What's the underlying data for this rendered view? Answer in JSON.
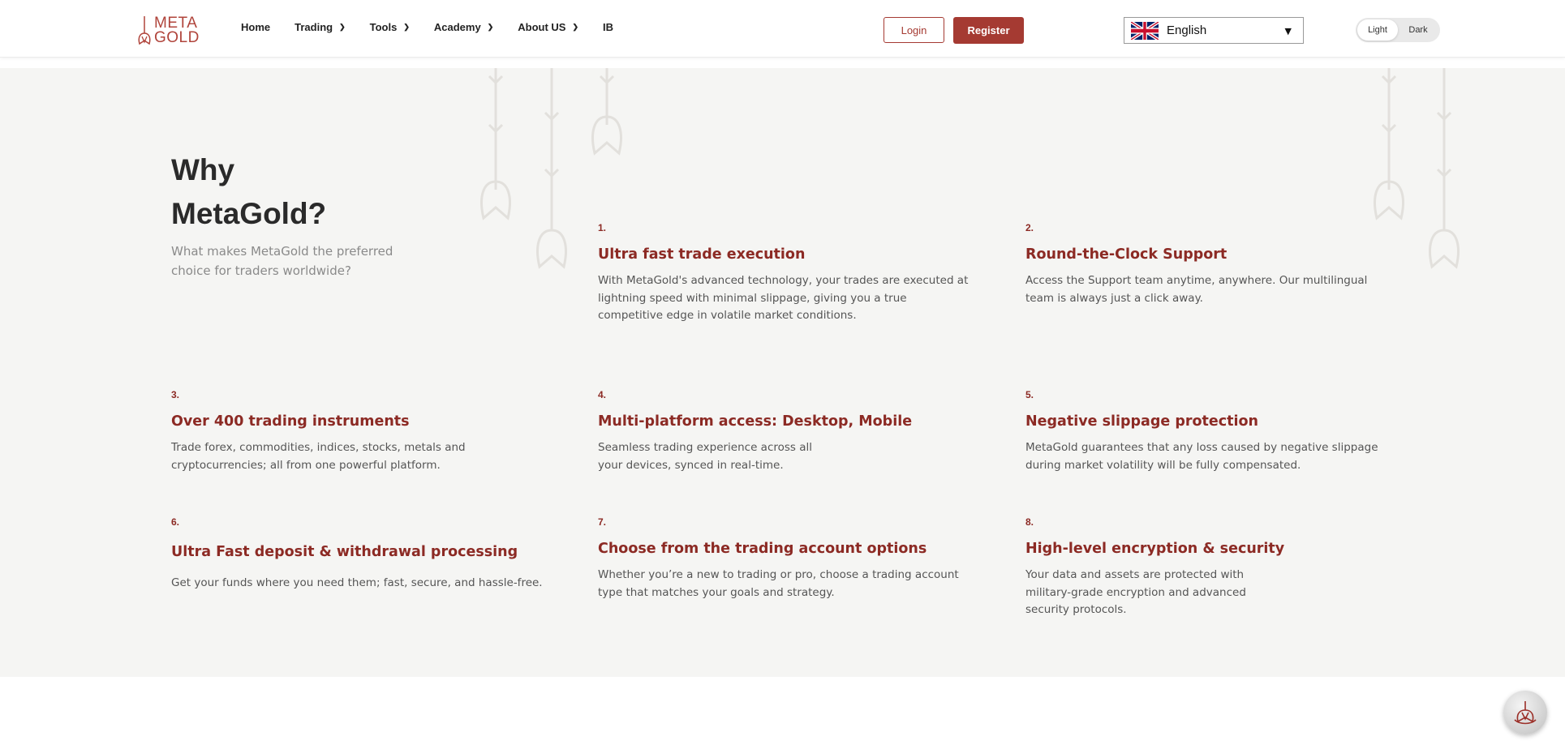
{
  "brand": {
    "line1": "META",
    "line2": "GOLD",
    "color": "#b0443b"
  },
  "nav": {
    "items": [
      {
        "label": "Home",
        "dropdown": false
      },
      {
        "label": "Trading",
        "dropdown": true
      },
      {
        "label": "Tools",
        "dropdown": true
      },
      {
        "label": "Academy",
        "dropdown": true
      },
      {
        "label": "About US",
        "dropdown": true
      },
      {
        "label": "IB",
        "dropdown": false
      }
    ]
  },
  "auth": {
    "login_label": "Login",
    "register_label": "Register",
    "accent": "#a53a32"
  },
  "language": {
    "selected": "English",
    "flag_icon": "uk-flag-icon"
  },
  "theme": {
    "light_label": "Light",
    "dark_label": "Dark",
    "active": "Light"
  },
  "why": {
    "title_line1": "Why",
    "title_line2": "MetaGold?",
    "subtitle": "What makes MetaGold the preferred choice for traders worldwide?",
    "features": [
      {
        "num": "1.",
        "title": "Ultra fast trade execution",
        "desc": "With MetaGold's advanced technology, your trades are executed at lightning speed with minimal slippage, giving you a true competitive edge in volatile market conditions."
      },
      {
        "num": "2.",
        "title": "Round-the-Clock Support",
        "desc": "Access the Support team anytime, anywhere. Our multilingual team is always just a click away."
      },
      {
        "num": "3.",
        "title": "Over 400 trading instruments",
        "desc": "Trade forex, commodities, indices, stocks, metals and cryptocurrencies; all from one powerful platform."
      },
      {
        "num": "4.",
        "title": "Multi-platform access: Desktop, Mobile",
        "desc": "Seamless trading experience across all your devices, synced in real-time."
      },
      {
        "num": "5.",
        "title": "Negative slippage protection",
        "desc": "MetaGold guarantees that any loss caused by negative slippage during market volatility will be fully compensated."
      },
      {
        "num": "6.",
        "title": "Ultra Fast deposit & withdrawal processing",
        "desc": "Get your funds where you need them; fast, secure, and hassle-free."
      },
      {
        "num": "7.",
        "title": "Choose from the trading account options",
        "desc": "Whether you’re a new to trading or pro, choose a trading account type that matches your goals and strategy."
      },
      {
        "num": "8.",
        "title": "High-level encryption & security",
        "desc": "Your data and assets are protected with military-grade encryption and advanced security protocols."
      }
    ]
  },
  "colors": {
    "section_bg": "#f5f5f3",
    "feature_accent": "#8c2a24"
  }
}
